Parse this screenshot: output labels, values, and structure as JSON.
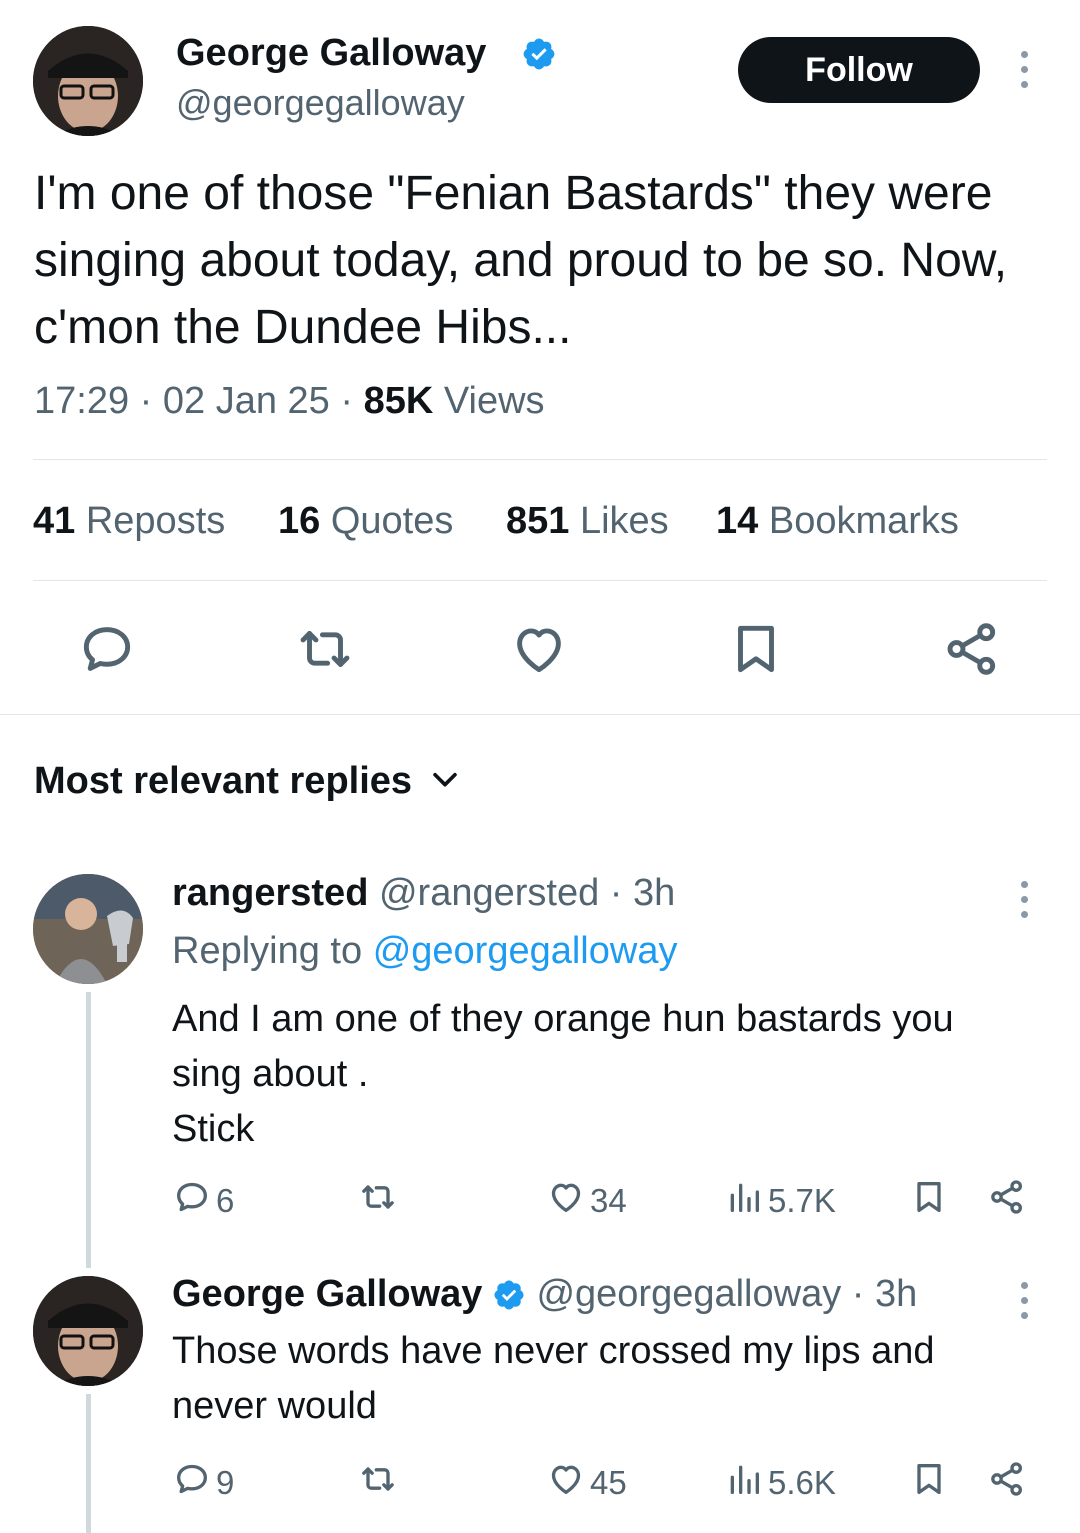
{
  "tweet": {
    "author_name": "George Galloway",
    "author_handle": "@georgegalloway",
    "follow_label": "Follow",
    "text": "I'm one of those \"Fenian Bastards\" they were singing about today, and proud to be so. Now, c'mon the Dundee Hibs...",
    "time": "17:29",
    "date": "02 Jan 25",
    "views_count": "85K",
    "views_label": "Views",
    "stats": [
      {
        "num": "41",
        "label": "Reposts"
      },
      {
        "num": "16",
        "label": "Quotes"
      },
      {
        "num": "851",
        "label": "Likes"
      },
      {
        "num": "14",
        "label": "Bookmarks"
      }
    ]
  },
  "replies_header": "Most relevant replies",
  "replies": [
    {
      "name": "rangersted",
      "handle": "@rangersted",
      "age": "3h",
      "replying_prefix": "Replying to",
      "replying_handle": "@georgegalloway",
      "text_lines": [
        "And I am one of they orange hun bastards you",
        "sing about .",
        "Stick"
      ],
      "replies": "6",
      "likes": "34",
      "views": "5.7K"
    },
    {
      "name": "George Galloway",
      "handle": "@georgegalloway",
      "age": "3h",
      "text_lines": [
        "Those words have never crossed my lips and",
        "never would"
      ],
      "replies": "9",
      "likes": "45",
      "views": "5.6K"
    }
  ],
  "colors": {
    "accent": "#1d9bf0",
    "text": "#0f1419",
    "muted": "#536471"
  }
}
